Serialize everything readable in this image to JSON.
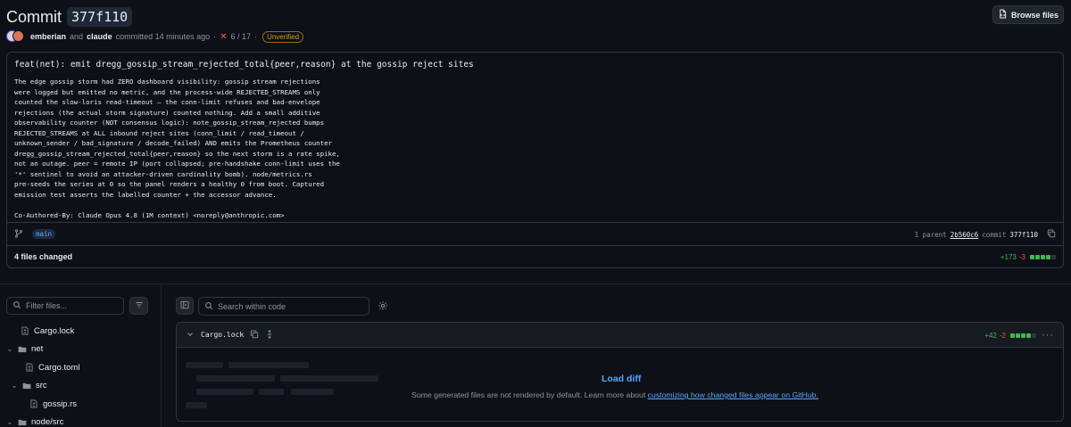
{
  "header": {
    "title_label": "Commit",
    "sha": "377f110",
    "browse_files": "Browse files",
    "author1": "emberian",
    "and_text": "and",
    "author2": "claude",
    "committed_text": "committed 14 minutes ago",
    "sep": "·",
    "checks_icon": "✕",
    "checks": "6 / 17",
    "verification": "Unverified"
  },
  "commit": {
    "headline": "feat(net): emit dregg_gossip_stream_rejected_total{peer,reason} at the gossip reject sites",
    "body": "The edge gossip storm had ZERO dashboard visibility: gossip stream rejections\nwere logged but emitted no metric, and the process-wide REJECTED_STREAMS only\ncounted the slow-loris read-timeout — the conn-limit refuses and bad-envelope\nrejections (the actual storm signature) counted nothing. Add a small additive\nobservability counter (NOT consensus logic): note_gossip_stream_rejected bumps\nREJECTED_STREAMS at ALL inbound reject sites (conn_limit / read_timeout /\nunknown_sender / bad_signature / decode_failed) AND emits the Prometheus counter\ndregg_gossip_stream_rejected_total{peer,reason} so the next storm is a rate spike,\nnot an outage. peer = remote IP (port collapsed; pre-handshake conn-limit uses the\n'*' sentinel to avoid an attacker-driven cardinality bomb). node/metrics.rs\npre-seeds the series at 0 so the panel renders a healthy 0 from boot. Captured\nemission test asserts the labelled counter + the accessor advance.\n\nCo-Authored-By: Claude Opus 4.8 (1M context) <noreply@anthropic.com>",
    "branch": "main",
    "parent_label": "1 parent",
    "parent_sha": "2b560c6",
    "commit_label": "commit",
    "commit_sha": "377f110",
    "files_changed": "4 files changed",
    "additions": "+173",
    "deletions": "-3"
  },
  "sidebar": {
    "filter_placeholder": "Filter files...",
    "tree": [
      {
        "label": "Cargo.lock",
        "type": "file",
        "depth": 0
      },
      {
        "label": "net",
        "type": "folder",
        "depth": 0
      },
      {
        "label": "Cargo.toml",
        "type": "file",
        "depth": 1
      },
      {
        "label": "src",
        "type": "folder",
        "depth": 1
      },
      {
        "label": "gossip.rs",
        "type": "file",
        "depth": 2
      },
      {
        "label": "node/src",
        "type": "folder",
        "depth": 0
      }
    ]
  },
  "diff": {
    "search_placeholder": "Search within code",
    "file": "Cargo.lock",
    "additions": "+42",
    "deletions": "-2",
    "more": "···",
    "load_diff": "Load diff",
    "note_prefix": "Some generated files are not rendered by default. Learn more about ",
    "note_link": "customizing how changed files appear on GitHub."
  },
  "colors": {
    "background": "#0d1117",
    "border": "#30363d",
    "accent_blue": "#58a6ff",
    "addition_green": "#3fb950",
    "deletion_red": "#f85149",
    "unverified_amber": "#d29922"
  }
}
